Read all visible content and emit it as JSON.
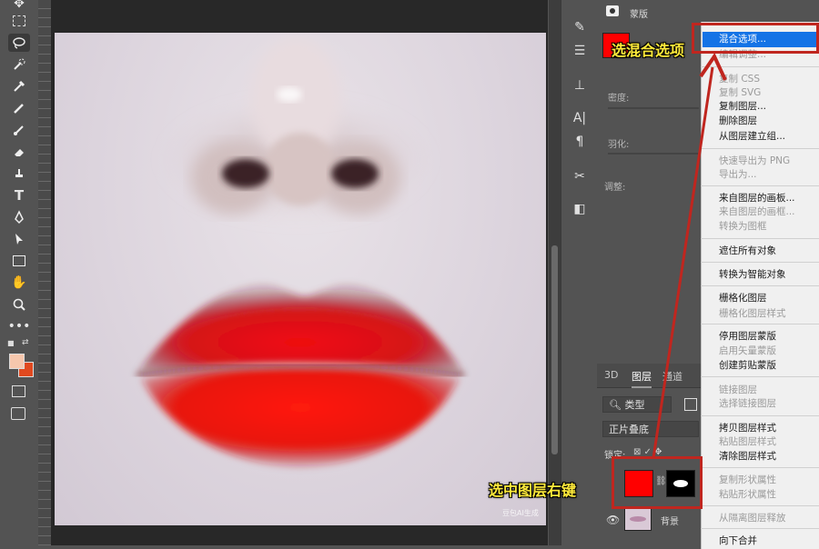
{
  "app": "Photoshop",
  "colors": {
    "foreground": "#f6c7ad",
    "background": "#e1491f",
    "menu_highlight": "#1473e6",
    "annotation": "#c0261f",
    "callout_text": "#ffeb3b"
  },
  "toolbar": {
    "tools": [
      "move-icon",
      "marquee-icon",
      "lasso-icon",
      "quick-select-icon",
      "eyedropper-icon",
      "healing-brush-icon",
      "brush-icon",
      "clone-stamp-icon",
      "history-brush-icon",
      "eraser-icon",
      "gradient-icon",
      "dodge-icon",
      "pen-icon",
      "type-icon",
      "path-select-icon",
      "rectangle-icon",
      "hand-icon",
      "zoom-icon",
      "more-icon"
    ],
    "type_tool_glyph": "T"
  },
  "canvas": {
    "watermark": "豆包AI生成"
  },
  "properties": {
    "mask_label": "蒙版",
    "density_label": "密度:",
    "feather_label": "羽化:",
    "refine_label": "调整:"
  },
  "layers_panel": {
    "tabs": [
      "3D",
      "图层",
      "通道"
    ],
    "filter_kind": "类型",
    "blend_mode": "正片叠底",
    "lock_label": "锁定:",
    "background_layer_name": "背景"
  },
  "context_menu": {
    "highlighted": "混合选项...",
    "items": [
      {
        "label": "混合选项...",
        "enabled": true
      },
      {
        "label": "编辑调整...",
        "enabled": false
      },
      {
        "label": "复制 CSS",
        "enabled": false
      },
      {
        "label": "复制 SVG",
        "enabled": false
      },
      {
        "label": "复制图层...",
        "enabled": true
      },
      {
        "label": "删除图层",
        "enabled": true
      },
      {
        "label": "从图层建立组...",
        "enabled": true
      },
      {
        "label": "快速导出为 PNG",
        "enabled": false
      },
      {
        "label": "导出为...",
        "enabled": false
      },
      {
        "label": "来自图层的画板...",
        "enabled": true
      },
      {
        "label": "来自图层的画框...",
        "enabled": false
      },
      {
        "label": "转换为图框",
        "enabled": false
      },
      {
        "label": "遮住所有对象",
        "enabled": true
      },
      {
        "label": "转换为智能对象",
        "enabled": true
      },
      {
        "label": "栅格化图层",
        "enabled": true
      },
      {
        "label": "栅格化图层样式",
        "enabled": false
      },
      {
        "label": "停用图层蒙版",
        "enabled": true
      },
      {
        "label": "启用矢量蒙版",
        "enabled": false
      },
      {
        "label": "创建剪贴蒙版",
        "enabled": true
      },
      {
        "label": "链接图层",
        "enabled": false
      },
      {
        "label": "选择链接图层",
        "enabled": false
      },
      {
        "label": "拷贝图层样式",
        "enabled": true
      },
      {
        "label": "粘贴图层样式",
        "enabled": false
      },
      {
        "label": "清除图层样式",
        "enabled": true
      },
      {
        "label": "复制形状属性",
        "enabled": false
      },
      {
        "label": "粘贴形状属性",
        "enabled": false
      },
      {
        "label": "从隔离图层释放",
        "enabled": false
      },
      {
        "label": "向下合并",
        "enabled": true
      }
    ]
  },
  "annotations": {
    "select_blend_options": "选混合选项",
    "right_click_layer": "选中图层右键"
  }
}
